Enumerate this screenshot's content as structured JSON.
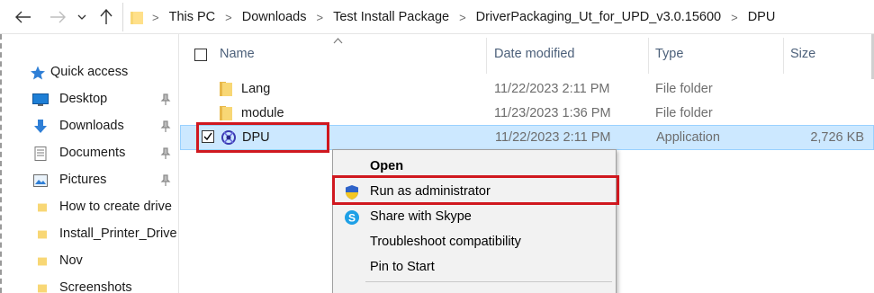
{
  "address_bar": {
    "breadcrumbs": [
      "This PC",
      "Downloads",
      "Test Install Package",
      "DriverPackaging_Ut_for_UPD_v3.0.15600",
      "DPU"
    ]
  },
  "nav_pane": {
    "items": [
      {
        "label": "Quick access",
        "icon": "star-icon",
        "pinned": false
      },
      {
        "label": "Desktop",
        "icon": "desktop-icon",
        "pinned": true
      },
      {
        "label": "Downloads",
        "icon": "download-arrow-icon",
        "pinned": true
      },
      {
        "label": "Documents",
        "icon": "documents-icon",
        "pinned": true
      },
      {
        "label": "Pictures",
        "icon": "pictures-icon",
        "pinned": true
      },
      {
        "label": "How to create drive",
        "icon": "folder-icon",
        "pinned": false
      },
      {
        "label": "Install_Printer_Drive",
        "icon": "folder-icon",
        "pinned": false
      },
      {
        "label": "Nov",
        "icon": "folder-icon",
        "pinned": false
      },
      {
        "label": "Screenshots",
        "icon": "folder-icon",
        "pinned": false
      }
    ]
  },
  "file_list": {
    "columns": {
      "name": "Name",
      "date": "Date modified",
      "type": "Type",
      "size": "Size"
    },
    "rows": [
      {
        "name": "Lang",
        "date": "11/22/2023 2:11 PM",
        "type": "File folder",
        "size": "",
        "icon": "folder-icon",
        "selected": false
      },
      {
        "name": "module",
        "date": "11/23/2023 1:36 PM",
        "type": "File folder",
        "size": "",
        "icon": "folder-icon",
        "selected": false
      },
      {
        "name": "DPU",
        "date": "11/22/2023 2:11 PM",
        "type": "Application",
        "size": "2,726 KB",
        "icon": "application-icon",
        "selected": true
      }
    ]
  },
  "context_menu": {
    "items": [
      {
        "label": "Open",
        "icon": "",
        "bold": true
      },
      {
        "label": "Run as administrator",
        "icon": "uac-shield-icon",
        "bold": false
      },
      {
        "label": "Share with Skype",
        "icon": "skype-icon",
        "bold": false
      },
      {
        "label": "Troubleshoot compatibility",
        "icon": "",
        "bold": false
      },
      {
        "label": "Pin to Start",
        "icon": "",
        "bold": false
      }
    ]
  },
  "colors": {
    "selection_bg": "#cce8ff",
    "highlight_outline": "#d0181f",
    "folder_yellow": "#f8d775",
    "header_text": "#4c607a"
  }
}
